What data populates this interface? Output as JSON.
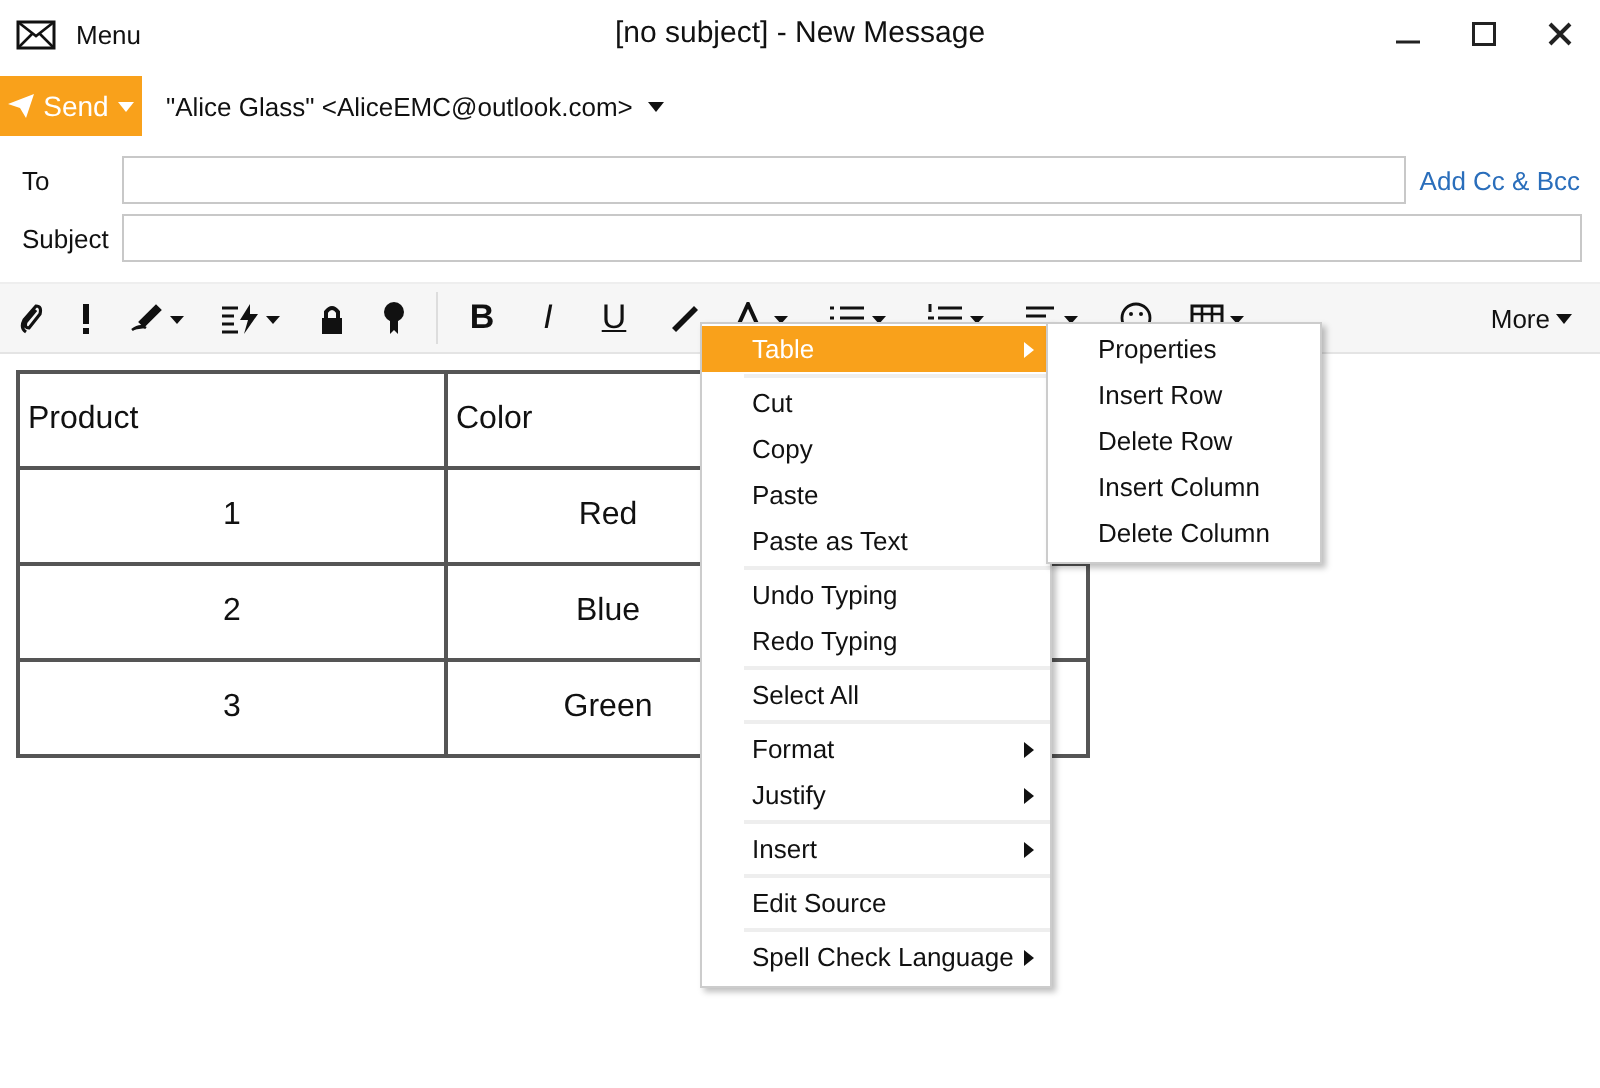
{
  "window": {
    "menu_label": "Menu",
    "title": "[no subject] - New Message"
  },
  "send_button": {
    "label": "Send"
  },
  "from": "\"Alice Glass\" <AliceEMC@outlook.com>",
  "to": {
    "label": "To",
    "link": "Add Cc & Bcc"
  },
  "subject": {
    "label": "Subject"
  },
  "toolbar": {
    "format_buttons": [
      "B",
      "I",
      "U"
    ],
    "more": "More"
  },
  "table": {
    "columns": [
      "Product",
      "Color"
    ],
    "rows": [
      [
        "1",
        "Red"
      ],
      [
        "2",
        "Blue"
      ],
      [
        "3",
        "Green"
      ]
    ]
  },
  "context_menu": {
    "items": [
      {
        "label": "Table",
        "selected": true,
        "submenu": true,
        "separator_before": false
      },
      {
        "label": "Cut",
        "selected": false,
        "submenu": false,
        "separator_before": true
      },
      {
        "label": "Copy",
        "selected": false,
        "submenu": false,
        "separator_before": false
      },
      {
        "label": "Paste",
        "selected": false,
        "submenu": false,
        "separator_before": false
      },
      {
        "label": "Paste as Text",
        "selected": false,
        "submenu": false,
        "separator_before": false
      },
      {
        "label": "Undo Typing",
        "selected": false,
        "submenu": false,
        "separator_before": true
      },
      {
        "label": "Redo Typing",
        "selected": false,
        "submenu": false,
        "separator_before": false
      },
      {
        "label": "Select All",
        "selected": false,
        "submenu": false,
        "separator_before": true
      },
      {
        "label": "Format",
        "selected": false,
        "submenu": true,
        "separator_before": true
      },
      {
        "label": "Justify",
        "selected": false,
        "submenu": true,
        "separator_before": false
      },
      {
        "label": "Insert",
        "selected": false,
        "submenu": true,
        "separator_before": true
      },
      {
        "label": "Edit Source",
        "selected": false,
        "submenu": false,
        "separator_before": true
      },
      {
        "label": "Spell Check Language",
        "selected": false,
        "submenu": true,
        "separator_before": true
      }
    ],
    "submenu": [
      "Properties",
      "Insert Row",
      "Delete Row",
      "Insert Column",
      "Delete Column"
    ]
  }
}
